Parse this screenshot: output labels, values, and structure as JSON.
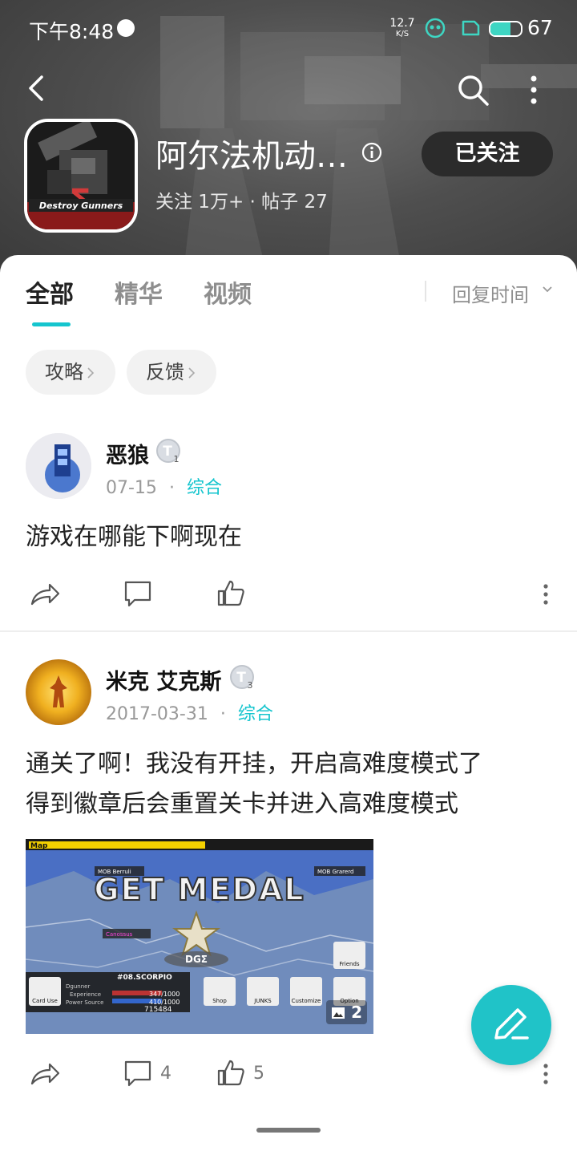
{
  "status_bar": {
    "time": "下午8:48",
    "net_speed_value": "12.7",
    "net_speed_unit": "K/S",
    "battery_level": 67,
    "battery_text": "67"
  },
  "header": {
    "game_name": "阿尔法机动…",
    "follow_button": "已关注",
    "stats": "关注 1万+ · 帖子 27",
    "icon_text": "Destroy Gunners",
    "icons": {
      "back": "back-arrow-icon",
      "search": "search-icon",
      "more": "more-vertical-icon",
      "info": "info-icon"
    }
  },
  "tabs": {
    "items": [
      "全部",
      "精华",
      "视频"
    ],
    "active_index": 0,
    "sort": "回复时间"
  },
  "chips": [
    "攻略",
    "反馈"
  ],
  "posts": [
    {
      "author": "恶狼",
      "level": "1",
      "date": "07-15",
      "category": "综合",
      "text": "游戏在哪能下啊现在",
      "comment_count": "",
      "like_count": ""
    },
    {
      "author": "米克 艾克斯",
      "level": "3",
      "date": "2017-03-31",
      "category": "综合",
      "text_line1": "通关了啊！我没有开挂，开启高难度模式了",
      "text_line2": "得到徽章后会重置关卡并进入高难度模式",
      "image_count": "2",
      "comment_count": "4",
      "like_count": "5",
      "image_texts": {
        "banner": "GET MEDAL",
        "map": "Map",
        "emblem": "DGΣ",
        "unit": "#08.SCORPIO",
        "exp": "347/1000",
        "power": "410/1000",
        "money": "715484",
        "labels": [
          "Dgunner",
          "Experience",
          "Power Source",
          "Card Use",
          "Shop",
          "JUNKS",
          "Customize",
          "Option",
          "Friends",
          "MOB Berruli",
          "MOB Grarerd",
          "Canossus"
        ]
      }
    }
  ],
  "colors": {
    "accent": "#15c5ce",
    "fab": "#20c3c8",
    "follow_bg": "#2b2b2b"
  }
}
